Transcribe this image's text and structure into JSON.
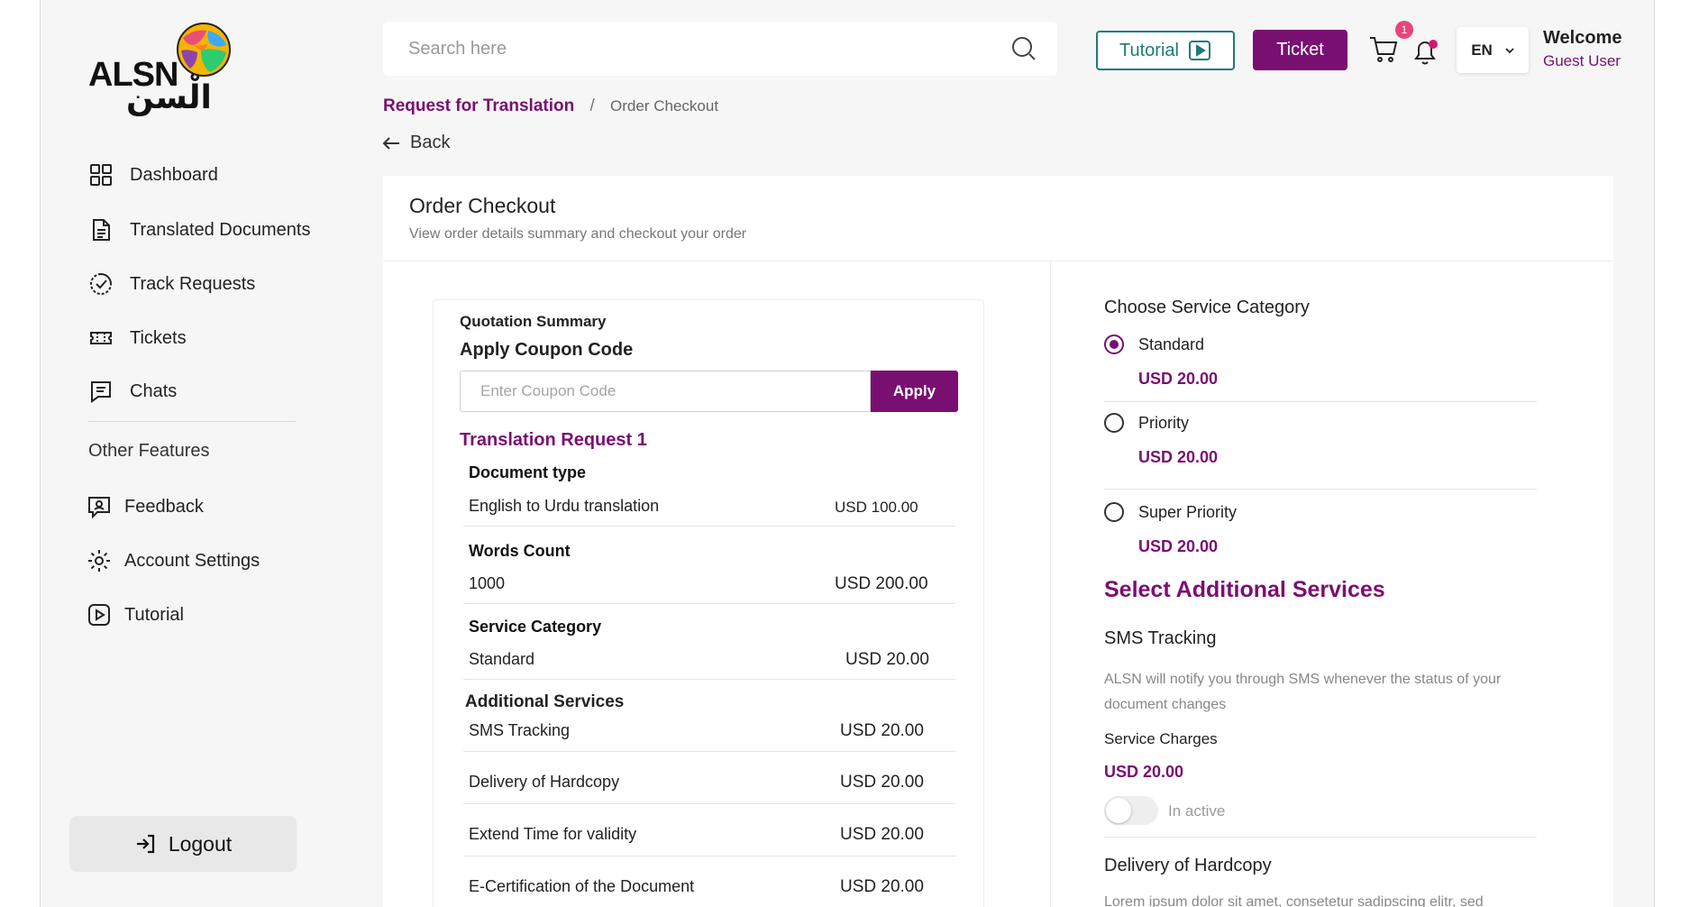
{
  "sidebar": {
    "logo_text": "ALSN",
    "logo_arabic": "الْسن",
    "items": [
      {
        "label": "Dashboard",
        "icon": "dashboard-icon"
      },
      {
        "label": "Translated Documents",
        "icon": "document-icon"
      },
      {
        "label": "Track Requests",
        "icon": "track-icon"
      },
      {
        "label": "Tickets",
        "icon": "ticket-icon"
      },
      {
        "label": "Chats",
        "icon": "chat-icon"
      }
    ],
    "other_label": "Other Features",
    "other_items": [
      {
        "label": "Feedback",
        "icon": "feedback-icon"
      },
      {
        "label": "Account Settings",
        "icon": "gear-icon"
      },
      {
        "label": "Tutorial",
        "icon": "play-icon"
      }
    ],
    "logout_label": "Logout"
  },
  "header": {
    "search_placeholder": "Search here",
    "tutorial_label": "Tutorial",
    "ticket_label": "Ticket",
    "cart_count": "1",
    "language": "EN",
    "welcome_title": "Welcome",
    "welcome_user": "Guest User"
  },
  "breadcrumb": {
    "parent": "Request for Translation",
    "separator": "/",
    "current": "Order Checkout"
  },
  "back_label": "Back",
  "card": {
    "title": "Order Checkout",
    "subtitle": "View order details summary and checkout your order"
  },
  "quotation": {
    "title": "Quotation Summary",
    "coupon_label": "Apply Coupon Code",
    "coupon_placeholder": "Enter Coupon Code",
    "apply_label": "Apply",
    "request_title": "Translation Request 1",
    "document_type_label": "Document type",
    "document_type_value": "English to Urdu translation",
    "document_type_price": "USD 100.00",
    "words_label": "Words Count",
    "words_value": "1000",
    "words_price": "USD 200.00",
    "service_label": "Service Category",
    "service_value": "Standard",
    "service_price": "USD 20.00",
    "additional_label": "Additional Services",
    "additional": [
      {
        "name": "SMS Tracking",
        "price": "USD 20.00"
      },
      {
        "name": "Delivery of Hardcopy",
        "price": "USD 20.00"
      },
      {
        "name": "Extend Time for validity",
        "price": "USD 20.00"
      },
      {
        "name": "E-Certification of the Document",
        "price": "USD 20.00"
      }
    ]
  },
  "service_category": {
    "title": "Choose Service Category",
    "options": [
      {
        "name": "Standard",
        "price": "USD 20.00",
        "selected": true
      },
      {
        "name": "Priority",
        "price": "USD 20.00",
        "selected": false
      },
      {
        "name": "Super Priority",
        "price": "USD 20.00",
        "selected": false
      }
    ]
  },
  "additional_services": {
    "title": "Select Additional Services",
    "sms_title": "SMS Tracking",
    "sms_desc": "ALSN will notify you through SMS whenever the status of your document changes",
    "charges_label": "Service Charges",
    "sms_price": "USD 20.00",
    "sms_toggle_label": "In active",
    "hardcopy_title": "Delivery of Hardcopy",
    "hardcopy_desc": "Lorem ipsum dolor sit amet, consetetur sadipscing elitr, sed"
  },
  "colors": {
    "brand_purple": "#7a0f72",
    "teal": "#1f7a78",
    "badge_pink": "#e8457a"
  }
}
